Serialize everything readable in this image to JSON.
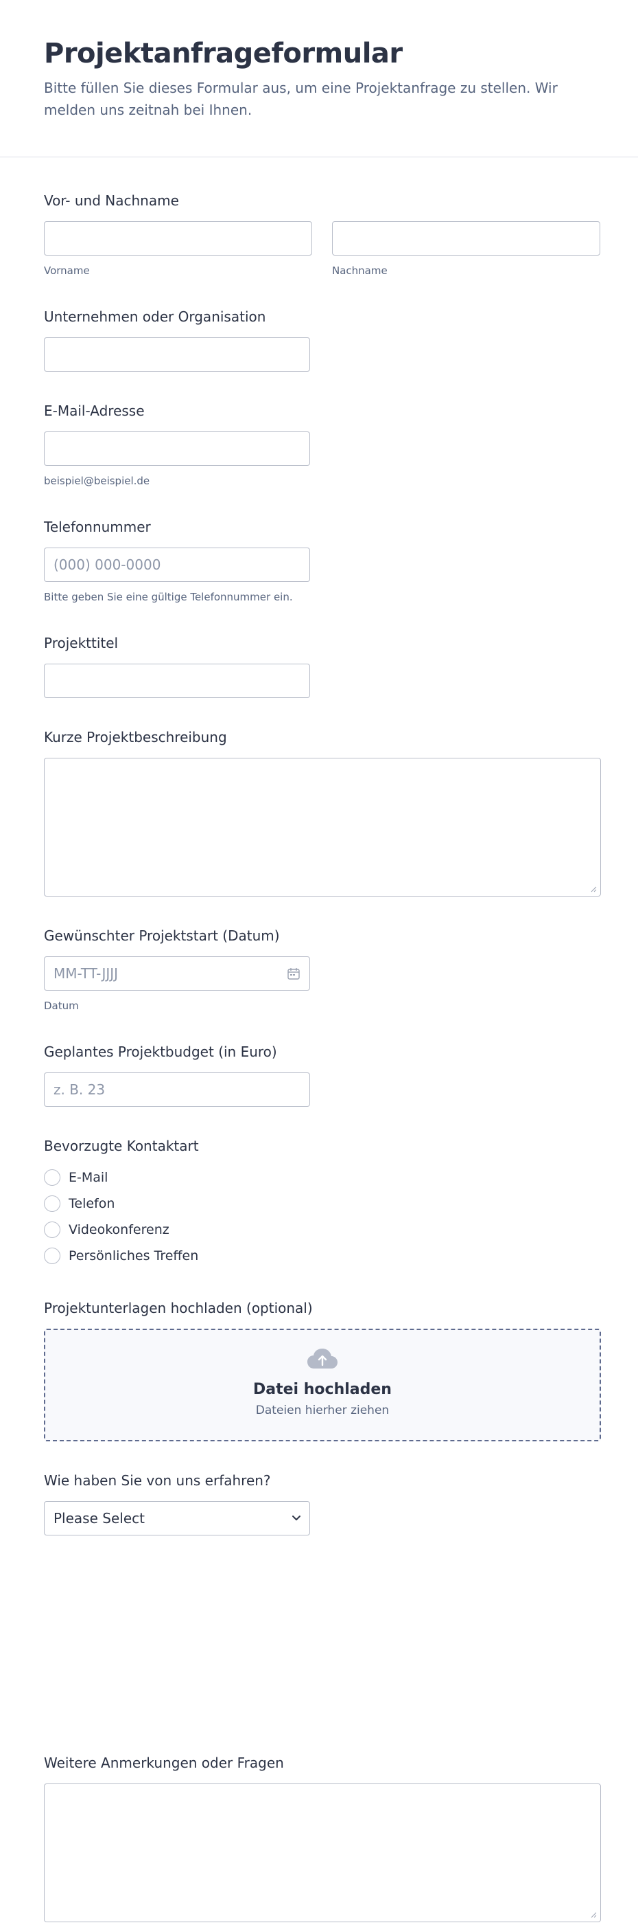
{
  "header": {
    "title": "Projektanfrageformular",
    "subtitle": "Bitte füllen Sie dieses Formular aus, um eine Projektanfrage zu stellen. Wir melden uns zeitnah bei Ihnen."
  },
  "fields": {
    "name": {
      "label": "Vor- und Nachname",
      "first_sublabel": "Vorname",
      "last_sublabel": "Nachname",
      "first_value": "",
      "last_value": ""
    },
    "company": {
      "label": "Unternehmen oder Organisation",
      "value": ""
    },
    "email": {
      "label": "E-Mail-Adresse",
      "value": "",
      "sublabel": "beispiel@beispiel.de"
    },
    "phone": {
      "label": "Telefonnummer",
      "placeholder": "(000) 000-0000",
      "sublabel": "Bitte geben Sie eine gültige Telefonnummer ein."
    },
    "project_title": {
      "label": "Projekttitel",
      "value": ""
    },
    "description": {
      "label": "Kurze Projektbeschreibung",
      "value": ""
    },
    "start_date": {
      "label": "Gewünschter Projektstart (Datum)",
      "placeholder": "MM-TT-JJJJ",
      "sublabel": "Datum"
    },
    "budget": {
      "label": "Geplantes Projektbudget (in Euro)",
      "placeholder": "z. B. 23"
    },
    "contact": {
      "label": "Bevorzugte Kontaktart",
      "options": [
        "E-Mail",
        "Telefon",
        "Videokonferenz",
        "Persönliches Treffen"
      ]
    },
    "upload": {
      "label": "Projektunterlagen hochladen (optional)",
      "title": "Datei hochladen",
      "subtitle": "Dateien hierher ziehen"
    },
    "source": {
      "label": "Wie haben Sie von uns erfahren?",
      "selected": "Please Select"
    },
    "notes": {
      "label": "Weitere Anmerkungen oder Fragen",
      "value": ""
    }
  },
  "colors": {
    "text": "#2c3345",
    "muted": "#57647e",
    "border": "#b8bdc9",
    "upload_border": "#5e6a8e",
    "upload_bg": "#f8f9fc"
  },
  "icons": {
    "calendar": "calendar-icon",
    "upload": "cloud-upload-icon",
    "select": "chevron-down-icon"
  }
}
